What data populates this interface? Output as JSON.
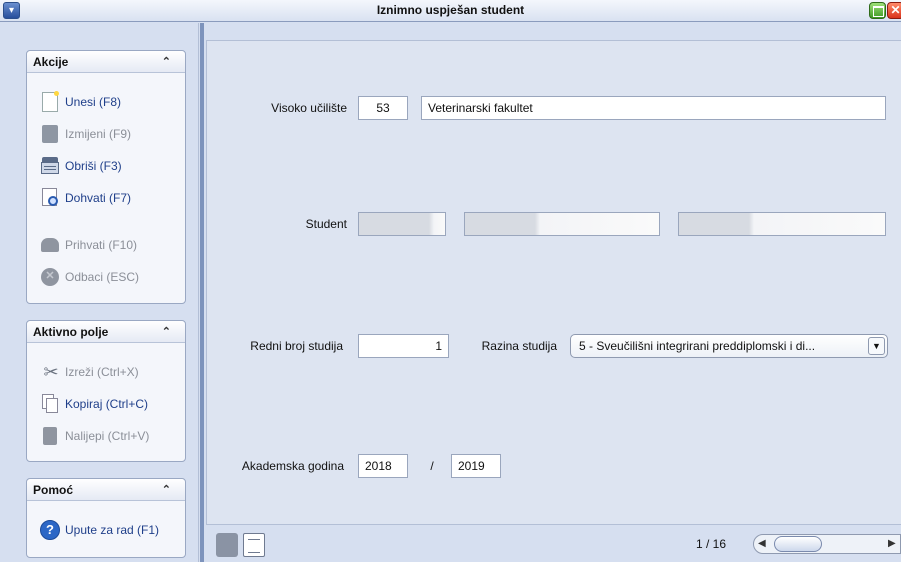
{
  "window": {
    "title": "Iznimno uspješan student"
  },
  "sidebar": {
    "akcije": {
      "title": "Akcije",
      "items": [
        {
          "label": "Unesi (F8)",
          "icon": "new-document-icon",
          "enabled": true
        },
        {
          "label": "Izmijeni (F9)",
          "icon": "edit-icon",
          "enabled": false
        },
        {
          "label": "Obriši (F3)",
          "icon": "delete-printer-icon",
          "enabled": true
        },
        {
          "label": "Dohvati (F7)",
          "icon": "search-document-icon",
          "enabled": true
        },
        {
          "label": "Prihvati (F10)",
          "icon": "accept-arrow-icon",
          "enabled": false
        },
        {
          "label": "Odbaci (ESC)",
          "icon": "cancel-icon",
          "enabled": false
        }
      ]
    },
    "aktivno_polje": {
      "title": "Aktivno polje",
      "items": [
        {
          "label": "Izreži (Ctrl+X)",
          "icon": "scissors-icon",
          "enabled": false
        },
        {
          "label": "Kopiraj (Ctrl+C)",
          "icon": "copy-icon",
          "enabled": true
        },
        {
          "label": "Nalijepi (Ctrl+V)",
          "icon": "paste-icon",
          "enabled": false
        }
      ]
    },
    "pomoc": {
      "title": "Pomoć",
      "items": [
        {
          "label": "Upute za rad (F1)",
          "icon": "help-icon",
          "enabled": true
        }
      ]
    },
    "collapse_glyph": "⌃"
  },
  "form": {
    "visoko_uciliste": {
      "label": "Visoko učilište",
      "code": "53",
      "name": "Veterinarski fakultet"
    },
    "student": {
      "label": "Student"
    },
    "redni_broj": {
      "label": "Redni broj studija",
      "value": "1"
    },
    "razina": {
      "label": "Razina studija",
      "value": "5 - Sveučilišni integrirani preddiplomski i di..."
    },
    "akademska_godina": {
      "label": "Akademska godina",
      "from": "2018",
      "separator": "/",
      "to": "2019"
    }
  },
  "footer": {
    "page_info": "1 / 16"
  }
}
